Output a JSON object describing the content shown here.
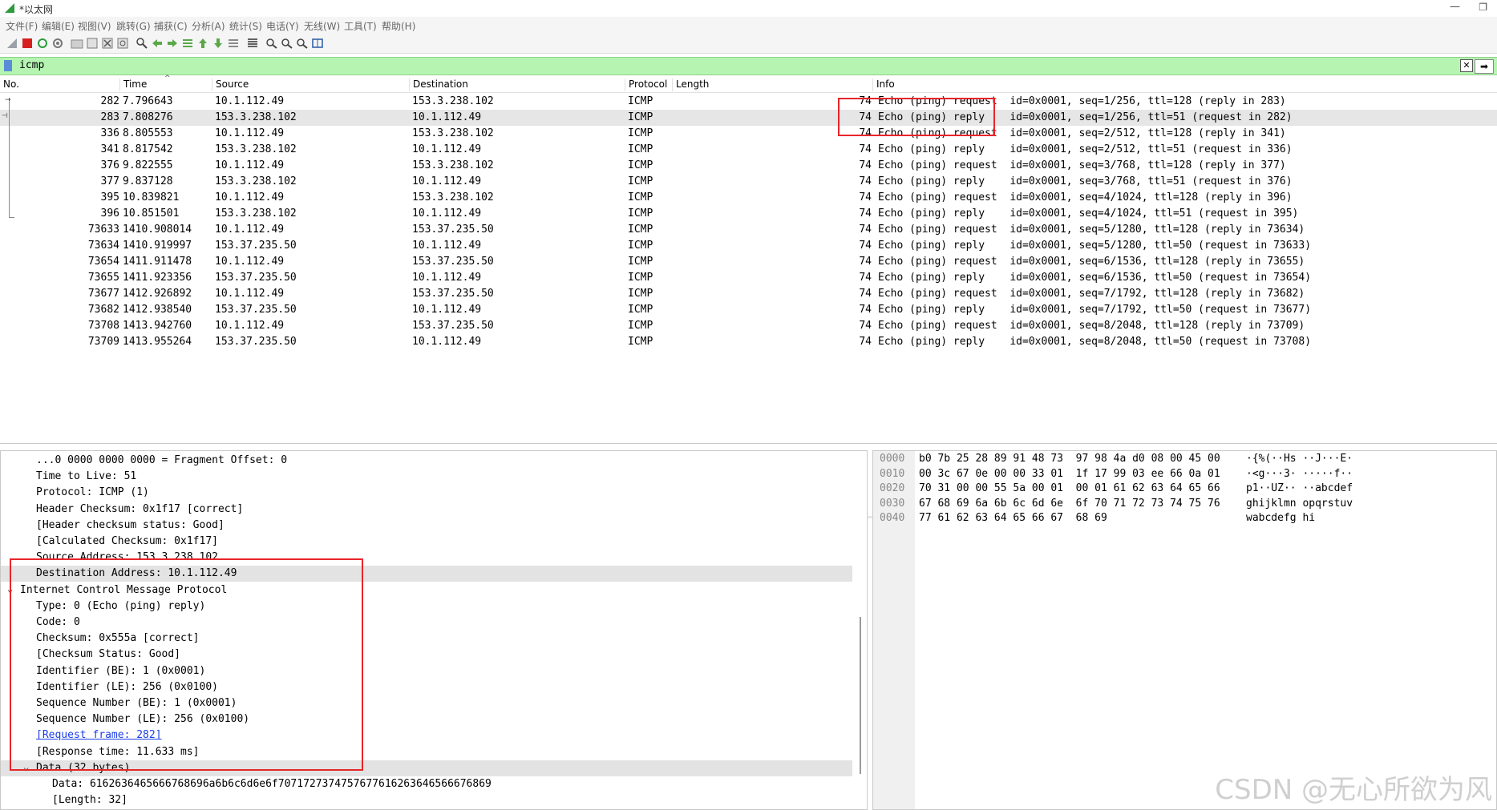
{
  "window": {
    "title": "*以太网",
    "minimize": "—",
    "restore": "❐"
  },
  "menu": [
    "文件(F)",
    "编辑(E)",
    "视图(V)",
    "跳转(G)",
    "捕获(C)",
    "分析(A)",
    "统计(S)",
    "电话(Y)",
    "无线(W)",
    "工具(T)",
    "帮助(H)"
  ],
  "toolbar": {
    "icons": [
      "shark-fin-start-icon",
      "stop-capture-icon",
      "restart-capture-icon",
      "capture-options-icon",
      "open-file-icon",
      "save-file-icon",
      "close-file-icon",
      "reload-file-icon",
      "find-packet-icon",
      "go-back-icon",
      "go-forward-icon",
      "go-to-packet-icon",
      "go-first-icon",
      "go-last-icon",
      "autoscroll-icon",
      "colorize-icon",
      "zoom-in-icon",
      "zoom-out-icon",
      "zoom-normal-icon",
      "resize-columns-icon"
    ]
  },
  "filter": {
    "value": "icmp",
    "clear_label": "✕",
    "apply_label": "➡",
    "bar_color": "#b5f5b1"
  },
  "packet_list": {
    "columns": [
      "No.",
      "Time",
      "Source",
      "Destination",
      "Protocol",
      "Length",
      "Info"
    ],
    "rows": [
      {
        "no": "282",
        "time": "7.796643",
        "src": "10.1.112.49",
        "dst": "153.3.238.102",
        "proto": "ICMP",
        "len": "74",
        "info": "Echo (ping) request  id=0x0001, seq=1/256, ttl=128 (reply in 283)"
      },
      {
        "no": "283",
        "time": "7.808276",
        "src": "153.3.238.102",
        "dst": "10.1.112.49",
        "proto": "ICMP",
        "len": "74",
        "info": "Echo (ping) reply    id=0x0001, seq=1/256, ttl=51 (request in 282)"
      },
      {
        "no": "336",
        "time": "8.805553",
        "src": "10.1.112.49",
        "dst": "153.3.238.102",
        "proto": "ICMP",
        "len": "74",
        "info": "Echo (ping) request  id=0x0001, seq=2/512, ttl=128 (reply in 341)"
      },
      {
        "no": "341",
        "time": "8.817542",
        "src": "153.3.238.102",
        "dst": "10.1.112.49",
        "proto": "ICMP",
        "len": "74",
        "info": "Echo (ping) reply    id=0x0001, seq=2/512, ttl=51 (request in 336)"
      },
      {
        "no": "376",
        "time": "9.822555",
        "src": "10.1.112.49",
        "dst": "153.3.238.102",
        "proto": "ICMP",
        "len": "74",
        "info": "Echo (ping) request  id=0x0001, seq=3/768, ttl=128 (reply in 377)"
      },
      {
        "no": "377",
        "time": "9.837128",
        "src": "153.3.238.102",
        "dst": "10.1.112.49",
        "proto": "ICMP",
        "len": "74",
        "info": "Echo (ping) reply    id=0x0001, seq=3/768, ttl=51 (request in 376)"
      },
      {
        "no": "395",
        "time": "10.839821",
        "src": "10.1.112.49",
        "dst": "153.3.238.102",
        "proto": "ICMP",
        "len": "74",
        "info": "Echo (ping) request  id=0x0001, seq=4/1024, ttl=128 (reply in 396)"
      },
      {
        "no": "396",
        "time": "10.851501",
        "src": "153.3.238.102",
        "dst": "10.1.112.49",
        "proto": "ICMP",
        "len": "74",
        "info": "Echo (ping) reply    id=0x0001, seq=4/1024, ttl=51 (request in 395)"
      },
      {
        "no": "73633",
        "time": "1410.908014",
        "src": "10.1.112.49",
        "dst": "153.37.235.50",
        "proto": "ICMP",
        "len": "74",
        "info": "Echo (ping) request  id=0x0001, seq=5/1280, ttl=128 (reply in 73634)"
      },
      {
        "no": "73634",
        "time": "1410.919997",
        "src": "153.37.235.50",
        "dst": "10.1.112.49",
        "proto": "ICMP",
        "len": "74",
        "info": "Echo (ping) reply    id=0x0001, seq=5/1280, ttl=50 (request in 73633)"
      },
      {
        "no": "73654",
        "time": "1411.911478",
        "src": "10.1.112.49",
        "dst": "153.37.235.50",
        "proto": "ICMP",
        "len": "74",
        "info": "Echo (ping) request  id=0x0001, seq=6/1536, ttl=128 (reply in 73655)"
      },
      {
        "no": "73655",
        "time": "1411.923356",
        "src": "153.37.235.50",
        "dst": "10.1.112.49",
        "proto": "ICMP",
        "len": "74",
        "info": "Echo (ping) reply    id=0x0001, seq=6/1536, ttl=50 (request in 73654)"
      },
      {
        "no": "73677",
        "time": "1412.926892",
        "src": "10.1.112.49",
        "dst": "153.37.235.50",
        "proto": "ICMP",
        "len": "74",
        "info": "Echo (ping) request  id=0x0001, seq=7/1792, ttl=128 (reply in 73682)"
      },
      {
        "no": "73682",
        "time": "1412.938540",
        "src": "153.37.235.50",
        "dst": "10.1.112.49",
        "proto": "ICMP",
        "len": "74",
        "info": "Echo (ping) reply    id=0x0001, seq=7/1792, ttl=50 (request in 73677)"
      },
      {
        "no": "73708",
        "time": "1413.942760",
        "src": "10.1.112.49",
        "dst": "153.37.235.50",
        "proto": "ICMP",
        "len": "74",
        "info": "Echo (ping) request  id=0x0001, seq=8/2048, ttl=128 (reply in 73709)"
      },
      {
        "no": "73709",
        "time": "1413.955264",
        "src": "153.37.235.50",
        "dst": "10.1.112.49",
        "proto": "ICMP",
        "len": "74",
        "info": "Echo (ping) reply    id=0x0001, seq=8/2048, ttl=50 (request in 73708)"
      }
    ],
    "selected_row": "283"
  },
  "details": {
    "lines": [
      {
        "text": "...0 0000 0000 0000 = Fragment Offset: 0"
      },
      {
        "text": "Time to Live: 51"
      },
      {
        "text": "Protocol: ICMP (1)"
      },
      {
        "text": "Header Checksum: 0x1f17 [correct]"
      },
      {
        "text": "[Header checksum status: Good]"
      },
      {
        "text": "[Calculated Checksum: 0x1f17]"
      },
      {
        "text": "Source Address: 153.3.238.102"
      },
      {
        "text": "Destination Address: 10.1.112.49"
      },
      {
        "text": "Internet Control Message Protocol",
        "caret": "⌄"
      },
      {
        "text": "Type: 0 (Echo (ping) reply)"
      },
      {
        "text": "Code: 0"
      },
      {
        "text": "Checksum: 0x555a [correct]"
      },
      {
        "text": "[Checksum Status: Good]"
      },
      {
        "text": "Identifier (BE): 1 (0x0001)"
      },
      {
        "text": "Identifier (LE): 256 (0x0100)"
      },
      {
        "text": "Sequence Number (BE): 1 (0x0001)"
      },
      {
        "text": "Sequence Number (LE): 256 (0x0100)"
      },
      {
        "text": "[Request frame: 282]"
      },
      {
        "text": "[Response time: 11.633 ms]"
      },
      {
        "text": "Data (32 bytes)",
        "caret": "⌄"
      },
      {
        "text": "Data: 6162636465666768696a6b6c6d6e6f7071727374757677616263646566676869"
      },
      {
        "text": "[Length: 32]"
      }
    ]
  },
  "bytes": {
    "rows": [
      {
        "offset": "0000",
        "hex": "b0 7b 25 28 89 91 48 73  97 98 4a d0 08 00 45 00",
        "ascii": "·{%(··Hs ··J···E·"
      },
      {
        "offset": "0010",
        "hex": "00 3c 67 0e 00 00 33 01  1f 17 99 03 ee 66 0a 01",
        "ascii": "·<g···3· ·····f··"
      },
      {
        "offset": "0020",
        "hex": "70 31 00 00 55 5a 00 01  00 01 61 62 63 64 65 66",
        "ascii": "p1··UZ·· ··abcdef"
      },
      {
        "offset": "0030",
        "hex": "67 68 69 6a 6b 6c 6d 6e  6f 70 71 72 73 74 75 76",
        "ascii": "ghijklmn opqrstuv"
      },
      {
        "offset": "0040",
        "hex": "77 61 62 63 64 65 66 67  68 69",
        "ascii": "wabcdefg hi"
      }
    ]
  },
  "watermark": "CSDN @无心所欲为风",
  "colors": {
    "highlight_box": "#e8252a",
    "selected_row": "#e6e6e6",
    "link": "#1a3ee8"
  }
}
